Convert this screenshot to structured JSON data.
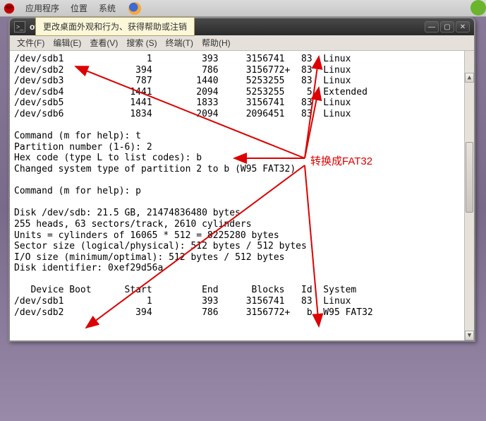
{
  "top_panel": {
    "apps": "应用程序",
    "places": "位置",
    "system": "系统",
    "tooltip": "更改桌面外观和行为、获得帮助或注销"
  },
  "window": {
    "title": "ot@c6-1:/dev",
    "menu": {
      "file": "文件(F)",
      "edit": "编辑(E)",
      "view": "查看(V)",
      "search": "搜索 (S)",
      "terminal": "终端(T)",
      "help": "帮助(H)"
    }
  },
  "terminal_lines": [
    "/dev/sdb1               1         393     3156741   83  Linux",
    "/dev/sdb2             394         786     3156772+  83  Linux",
    "/dev/sdb3             787        1440     5253255   83  Linux",
    "/dev/sdb4            1441        2094     5253255    5  Extended",
    "/dev/sdb5            1441        1833     3156741   83  Linux",
    "/dev/sdb6            1834        2094     2096451   83  Linux",
    "",
    "Command (m for help): t",
    "Partition number (1-6): 2",
    "Hex code (type L to list codes): b",
    "Changed system type of partition 2 to b (W95 FAT32)",
    "",
    "Command (m for help): p",
    "",
    "Disk /dev/sdb: 21.5 GB, 21474836480 bytes",
    "255 heads, 63 sectors/track, 2610 cylinders",
    "Units = cylinders of 16065 * 512 = 8225280 bytes",
    "Sector size (logical/physical): 512 bytes / 512 bytes",
    "I/O size (minimum/optimal): 512 bytes / 512 bytes",
    "Disk identifier: 0xef29d56a",
    "",
    "   Device Boot      Start         End      Blocks   Id  System",
    "/dev/sdb1               1         393     3156741   83  Linux",
    "/dev/sdb2             394         786     3156772+   b  W95 FAT32"
  ],
  "annotation": {
    "label": "转换成FAT32"
  }
}
